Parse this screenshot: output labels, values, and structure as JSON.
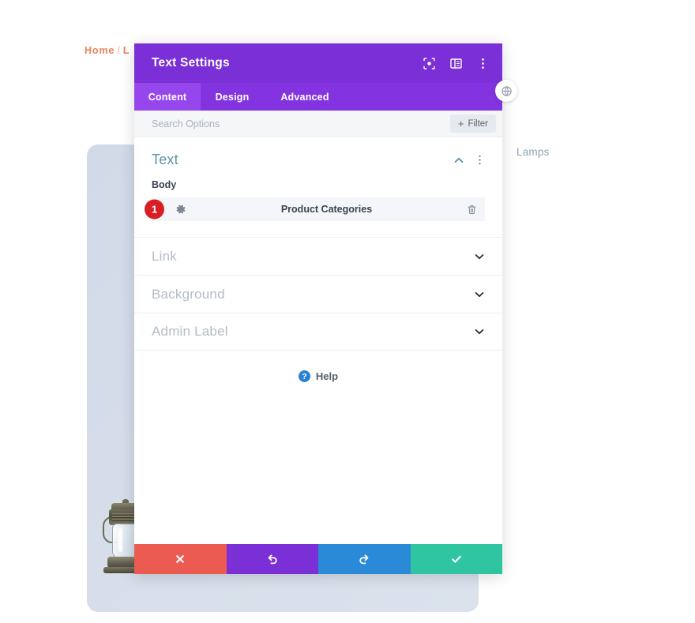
{
  "background_page": {
    "breadcrumb": {
      "home": "Home",
      "separator": "/",
      "current_partial": "L"
    },
    "category_link": "Lamps",
    "product_image_alt": "lantern-product-image"
  },
  "modal": {
    "title": "Text Settings",
    "header_icons": [
      {
        "name": "focus-target-icon"
      },
      {
        "name": "panel-layout-icon"
      },
      {
        "name": "more-vertical-icon"
      }
    ],
    "tabs": [
      {
        "label": "Content",
        "active": true
      },
      {
        "label": "Design",
        "active": false
      },
      {
        "label": "Advanced",
        "active": false
      }
    ],
    "search": {
      "placeholder": "Search Options",
      "value": ""
    },
    "filter_button": {
      "plus": "+",
      "label": "Filter"
    },
    "text_section": {
      "title": "Text",
      "collapse_state": "expanded",
      "field_label": "Body",
      "row": {
        "badge": "1",
        "value": "Product Categories"
      }
    },
    "accordion": [
      {
        "label": "Link",
        "state": "collapsed"
      },
      {
        "label": "Background",
        "state": "collapsed"
      },
      {
        "label": "Admin Label",
        "state": "collapsed"
      }
    ],
    "help": {
      "glyph": "?",
      "label": "Help"
    },
    "footer_buttons": [
      {
        "name": "cancel",
        "icon": "close-icon",
        "color": "#ec5b52"
      },
      {
        "name": "undo",
        "icon": "undo-icon",
        "color": "#7b2fd6"
      },
      {
        "name": "redo",
        "icon": "redo-icon",
        "color": "#2a8ad8"
      },
      {
        "name": "save",
        "icon": "check-icon",
        "color": "#2ec5a0"
      }
    ]
  },
  "colors": {
    "header_purple": "#7b2fd6",
    "tabbar_purple": "#8334e0",
    "tab_active_purple": "#9647ec",
    "badge_red": "#d81f26",
    "section_title_blue": "#5b93a8",
    "breadcrumb_orange": "#e8835a",
    "panel_bluegray": "#d6dde9"
  }
}
